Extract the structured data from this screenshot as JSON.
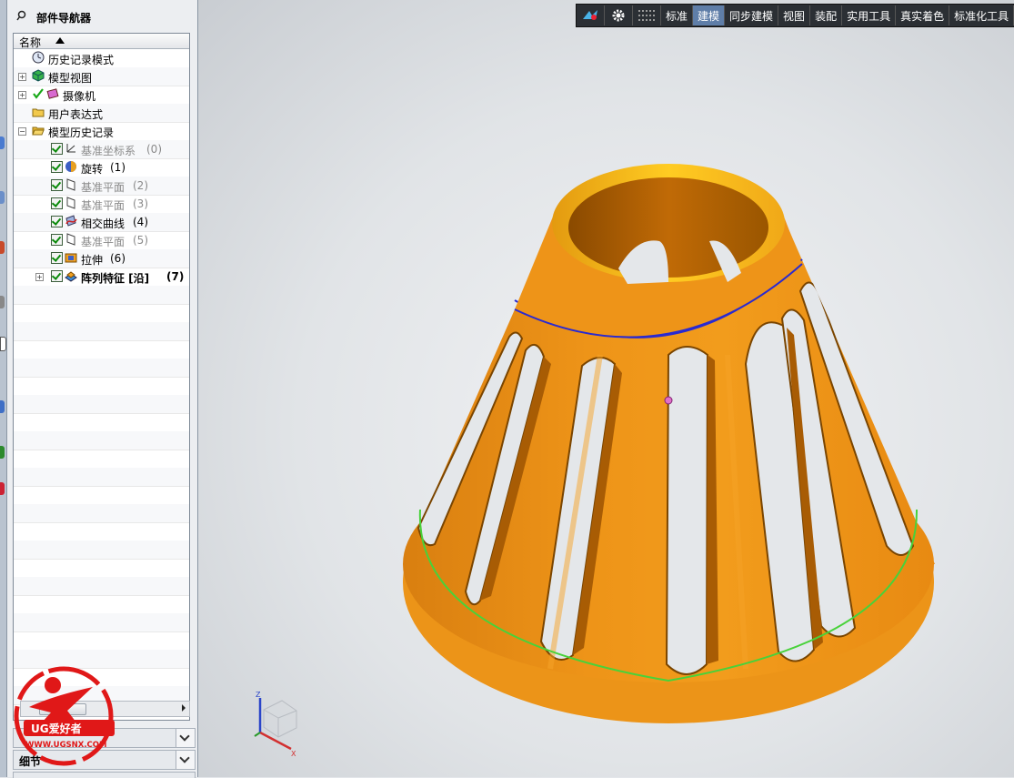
{
  "navigator": {
    "title": "部件导航器",
    "column_name": "名称",
    "tree": [
      {
        "label": "历史记录模式",
        "icon": "clock-icon",
        "state": "normal"
      },
      {
        "label": "模型视图",
        "icon": "model-views-icon",
        "state": "normal"
      },
      {
        "label": "摄像机",
        "icon": "camera-icon",
        "state": "normal"
      },
      {
        "label": "用户表达式",
        "icon": "folder-icon",
        "state": "normal"
      },
      {
        "label": "模型历史记录",
        "icon": "folder-open-icon",
        "state": "normal"
      },
      {
        "label": "基准坐标系",
        "num": "(0)",
        "icon": "datum-csys-icon",
        "state": "dim"
      },
      {
        "label": "旋转",
        "num": "(1)",
        "icon": "revolve-icon",
        "state": "normal"
      },
      {
        "label": "基准平面",
        "num": "(2)",
        "icon": "datum-plane-icon",
        "state": "dim"
      },
      {
        "label": "基准平面",
        "num": "(3)",
        "icon": "datum-plane-icon",
        "state": "dim"
      },
      {
        "label": "相交曲线",
        "num": "(4)",
        "icon": "intersection-curve-icon",
        "state": "normal"
      },
      {
        "label": "基准平面",
        "num": "(5)",
        "icon": "datum-plane-icon",
        "state": "dim"
      },
      {
        "label": "拉伸",
        "num": "(6)",
        "icon": "extrude-icon",
        "state": "normal"
      },
      {
        "label": "阵列特征 [沿]",
        "num": "(7)",
        "icon": "pattern-feature-icon",
        "state": "bold"
      }
    ],
    "panel_details": "细节"
  },
  "toolbar": {
    "tabs": [
      "标准",
      "建模",
      "同步建模",
      "视图",
      "装配",
      "实用工具",
      "真实着色",
      "标准化工具"
    ],
    "active_tab": "建模"
  },
  "watermark": {
    "brand": "UG爱好者",
    "url": "WWW.UGSNX.COM"
  },
  "triad": {
    "z": "Z",
    "x": "X"
  },
  "colors": {
    "model_orange": "#f09a1a",
    "toolbar_bg": "#2b2f34",
    "active_tab": "#5f7ea8",
    "curve_green": "#48d23a",
    "curve_blue": "#2a2ad0"
  }
}
